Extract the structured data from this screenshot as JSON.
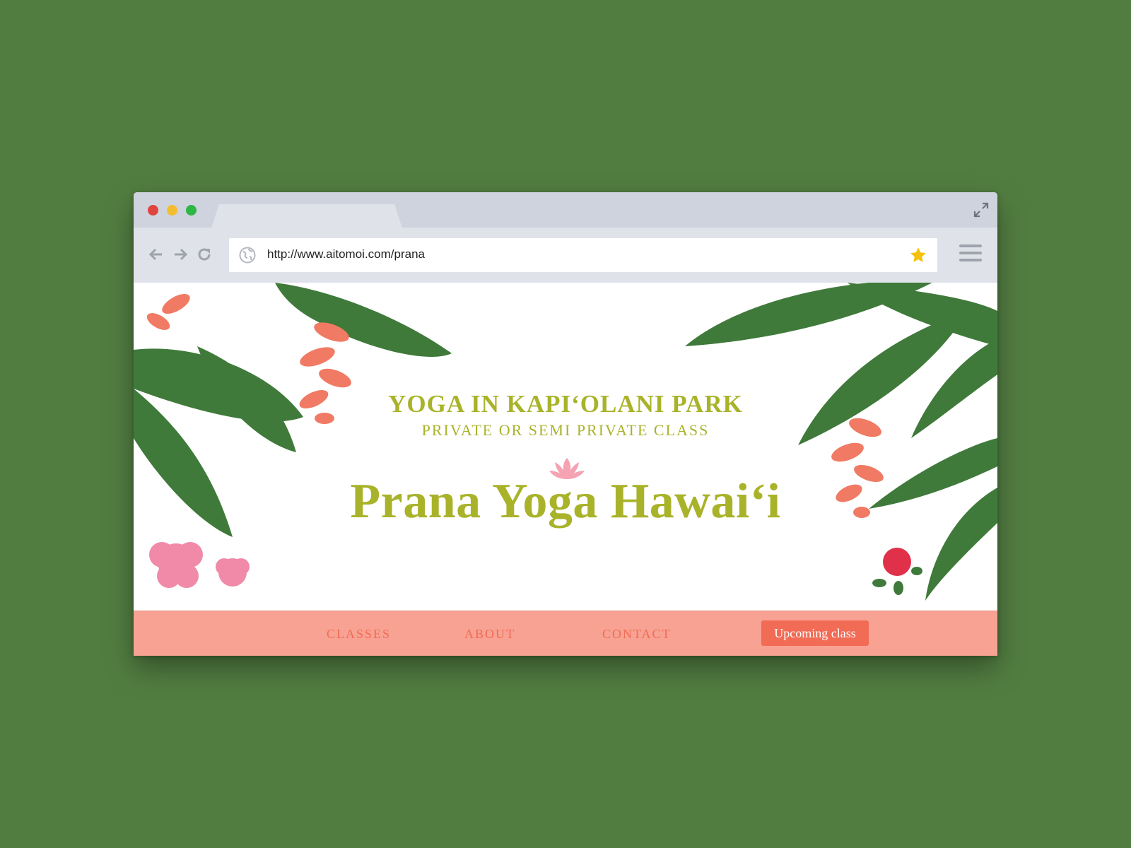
{
  "browser": {
    "url": "http://www.aitomoi.com/prana",
    "icons": [
      "back-arrow-icon",
      "forward-arrow-icon",
      "reload-icon",
      "globe-icon",
      "star-icon",
      "hamburger-menu-icon",
      "expand-icon"
    ],
    "colors": {
      "red": "#e0443e",
      "yellow": "#f4bd2f",
      "green": "#2db546",
      "star": "#f4c20d"
    }
  },
  "hero": {
    "headline": "YOGA IN KAPI‘OLANI PARK",
    "subheadline": "PRIVATE OR SEMI PRIVATE CLASS",
    "brand": "Prana Yoga Hawai‘i",
    "colors": {
      "text": "#a9b32a",
      "leaf": "#3f7a3a",
      "heliconia": "#f07a63",
      "hibiscus": "#f08aa8"
    }
  },
  "nav": {
    "classes": "CLASSES",
    "about": "ABOUT",
    "contact": "CONTACT",
    "cta": "Upcoming class",
    "colors": {
      "bar": "#f7a293",
      "link": "#f26b55",
      "cta_bg": "#f26b55"
    }
  }
}
